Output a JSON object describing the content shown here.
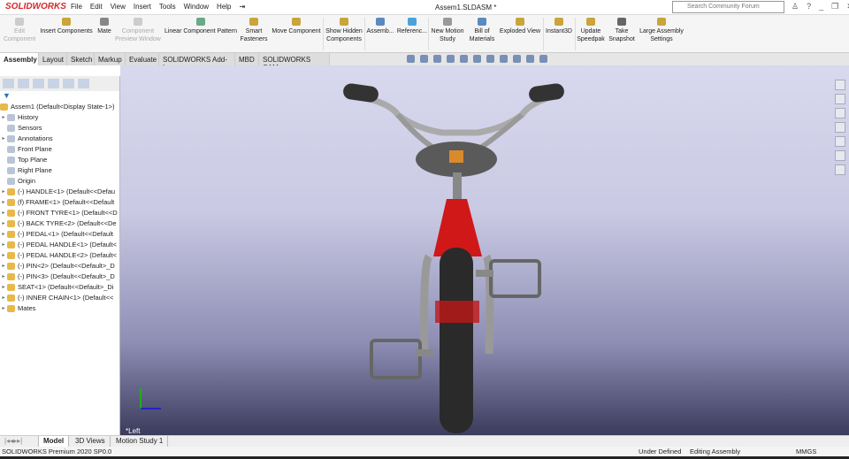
{
  "app": {
    "logo": "SOLIDWORKS",
    "document_title": "Assem1.SLDASM *"
  },
  "menu": [
    "File",
    "Edit",
    "View",
    "Insert",
    "Tools",
    "Window",
    "Help"
  ],
  "search": {
    "placeholder": "Search Community Forum"
  },
  "ribbon": [
    {
      "label": "Edit Component",
      "disabled": true
    },
    {
      "label": "Insert Components",
      "disabled": false
    },
    {
      "label": "Mate",
      "disabled": false
    },
    {
      "label": "Component Preview Window",
      "disabled": true
    },
    {
      "label": "Linear Component Pattern",
      "disabled": false
    },
    {
      "label": "Smart Fasteners",
      "disabled": false
    },
    {
      "label": "Move Component",
      "disabled": false
    },
    {
      "label": "Show Hidden Components",
      "disabled": false
    },
    {
      "label": "Assemb...",
      "disabled": false
    },
    {
      "label": "Referenc...",
      "disabled": false
    },
    {
      "label": "New Motion Study",
      "disabled": false
    },
    {
      "label": "Bill of Materials",
      "disabled": false
    },
    {
      "label": "Exploded View",
      "disabled": false
    },
    {
      "label": "Instant3D",
      "disabled": false
    },
    {
      "label": "Update Speedpak",
      "disabled": false
    },
    {
      "label": "Take Snapshot",
      "disabled": false
    },
    {
      "label": "Large Assembly Settings",
      "disabled": false
    }
  ],
  "tabs": [
    "Assembly",
    "Layout",
    "Sketch",
    "Markup",
    "Evaluate",
    "SOLIDWORKS Add-Ins",
    "MBD",
    "SOLIDWORKS CAM"
  ],
  "tree": {
    "root": "Assem1  (Default<Display State-1>)",
    "items": [
      {
        "label": "History",
        "arrow": true
      },
      {
        "label": "Sensors",
        "arrow": false
      },
      {
        "label": "Annotations",
        "arrow": true
      },
      {
        "label": "Front Plane",
        "arrow": false
      },
      {
        "label": "Top Plane",
        "arrow": false
      },
      {
        "label": "Right Plane",
        "arrow": false
      },
      {
        "label": "Origin",
        "arrow": false
      },
      {
        "label": "(-) HANDLE<1> (Default<<Defau",
        "arrow": true
      },
      {
        "label": "(f) FRAME<1> (Default<<Default",
        "arrow": true
      },
      {
        "label": "(-) FRONT TYRE<1> (Default<<D",
        "arrow": true
      },
      {
        "label": "(-) BACK TYRE<2> (Default<<De",
        "arrow": true
      },
      {
        "label": "(-) PEDAL<1> (Default<<Default",
        "arrow": true
      },
      {
        "label": "(-) PEDAL HANDLE<1> (Default<",
        "arrow": true
      },
      {
        "label": "(-) PEDAL HANDLE<2> (Default<",
        "arrow": true
      },
      {
        "label": "(-) PIN<2> (Default<<Default>_D",
        "arrow": true
      },
      {
        "label": "(-) PIN<3> (Default<<Default>_D",
        "arrow": true
      },
      {
        "label": "SEAT<1> (Default<<Default>_Di",
        "arrow": true
      },
      {
        "label": "(-) INNER CHAIN<1> (Default<<",
        "arrow": true
      },
      {
        "label": "Mates",
        "arrow": true
      }
    ]
  },
  "viewport": {
    "view_label": "*Left"
  },
  "bottom_tabs": [
    "Model",
    "3D Views",
    "Motion Study 1"
  ],
  "status": {
    "product": "SOLIDWORKS Premium 2020 SP0.0",
    "state": "Under Defined",
    "mode": "Editing Assembly",
    "units": "MMGS"
  }
}
